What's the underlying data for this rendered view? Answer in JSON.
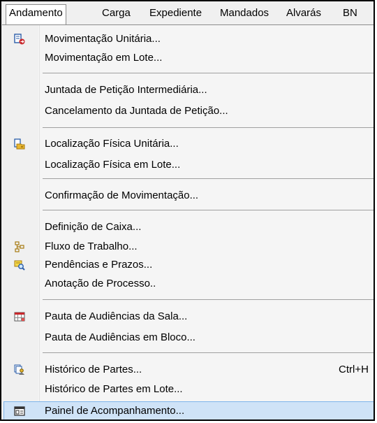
{
  "menubar": {
    "items": [
      "Andamento",
      "Carga",
      "Expediente",
      "Mandados",
      "Alvarás",
      "BN"
    ]
  },
  "menu": {
    "items": [
      {
        "label": "Movimentação Unitária...",
        "icon": "move-doc-icon"
      },
      {
        "label": "Movimentação em Lote..."
      },
      {
        "label": "Juntada de Petição Intermediária..."
      },
      {
        "label": "Cancelamento da Juntada de Petição..."
      },
      {
        "label": "Localização Física Unitária...",
        "icon": "folder-location-icon"
      },
      {
        "label": "Localização Física em Lote..."
      },
      {
        "label": "Confirmação de Movimentação..."
      },
      {
        "label": "Definição de Caixa..."
      },
      {
        "label": "Fluxo de Trabalho...",
        "icon": "workflow-icon"
      },
      {
        "label": "Pendências e Prazos...",
        "icon": "search-doc-icon"
      },
      {
        "label": "Anotação de Processo.."
      },
      {
        "label": "Pauta de Audiências da Sala...",
        "icon": "calendar-grid-icon"
      },
      {
        "label": "Pauta de Audiências em Bloco..."
      },
      {
        "label": "Histórico de Partes...",
        "icon": "history-people-icon",
        "shortcut": "Ctrl+H"
      },
      {
        "label": "Histórico de Partes em Lote..."
      },
      {
        "label": "Painel de Acompanhamento...",
        "icon": "panel-icon",
        "selected": true
      }
    ]
  },
  "colors": {
    "menu_background": "#f0f0f0",
    "highlight_fill": "#cfe3f7",
    "highlight_border": "#7eb4ea",
    "separator": "#a0a0a0"
  }
}
